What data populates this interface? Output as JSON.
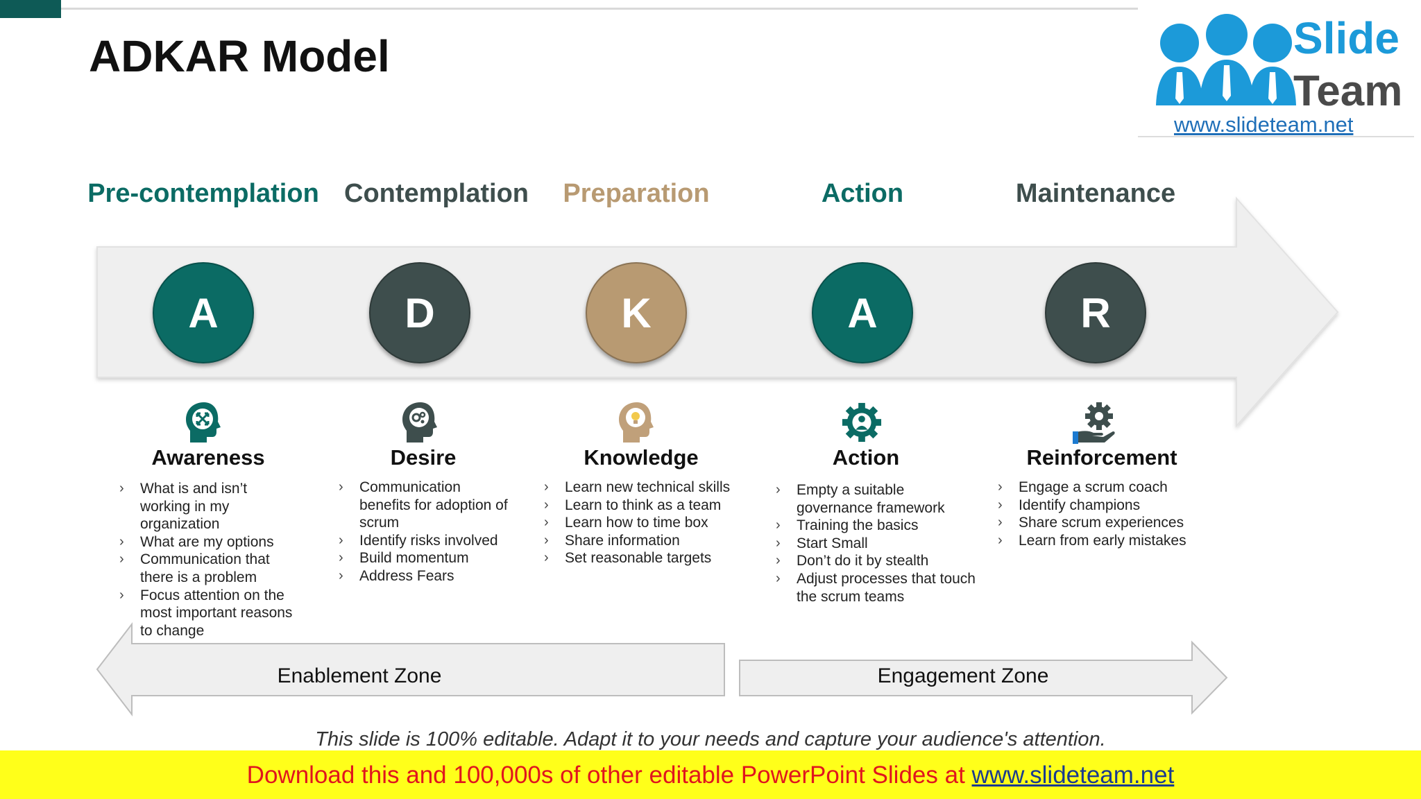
{
  "slide": {
    "title": "ADKAR Model",
    "footnote": "This slide is 100% editable. Adapt it to your needs and capture your audience's attention."
  },
  "logo": {
    "word1": "Slide",
    "word2": "Team",
    "url": "www.slideteam.net"
  },
  "stages": [
    {
      "heading": "Pre-contemplation",
      "heading_color": "#0b6b64",
      "letter": "A",
      "label": "Awareness",
      "bullets": [
        "What is and isn’t working in my organization",
        "What are my options",
        "Communication that there is a problem",
        "Focus attention on the most important reasons to change"
      ]
    },
    {
      "heading": "Contemplation",
      "heading_color": "#3e4e4d",
      "letter": "D",
      "label": "Desire",
      "bullets": [
        "Communication benefits for adoption of scrum",
        "Identify risks involved",
        "Build momentum",
        "Address Fears"
      ]
    },
    {
      "heading": "Preparation",
      "heading_color": "#b89a72",
      "letter": "K",
      "label": "Knowledge",
      "bullets": [
        "Learn new technical skills",
        "Learn to think as a team",
        "Learn how to time box",
        "Share information",
        "Set reasonable targets"
      ]
    },
    {
      "heading": "Action",
      "heading_color": "#0b6b64",
      "letter": "A",
      "label": "Action",
      "bullets": [
        "Empty a suitable governance framework",
        "Training the basics",
        "Start Small",
        "Don’t do it by stealth",
        "Adjust processes that touch the scrum teams"
      ]
    },
    {
      "heading": "Maintenance",
      "heading_color": "#3e4e4d",
      "letter": "R",
      "label": "Reinforcement",
      "bullets": [
        "Engage a scrum coach",
        "Identify champions",
        "Share scrum experiences",
        "Learn from early mistakes"
      ]
    }
  ],
  "zones": {
    "left": "Enablement Zone",
    "right": "Engagement Zone"
  },
  "banner": {
    "text": "Download this and 100,000s of other editable PowerPoint Slides at ",
    "link": "www.slideteam.net"
  },
  "colors": {
    "teal": "#0b6b64",
    "slate": "#3e4e4d",
    "tan": "#b89a72",
    "banner_bg": "#ffff1a",
    "banner_text": "#e0151e"
  }
}
